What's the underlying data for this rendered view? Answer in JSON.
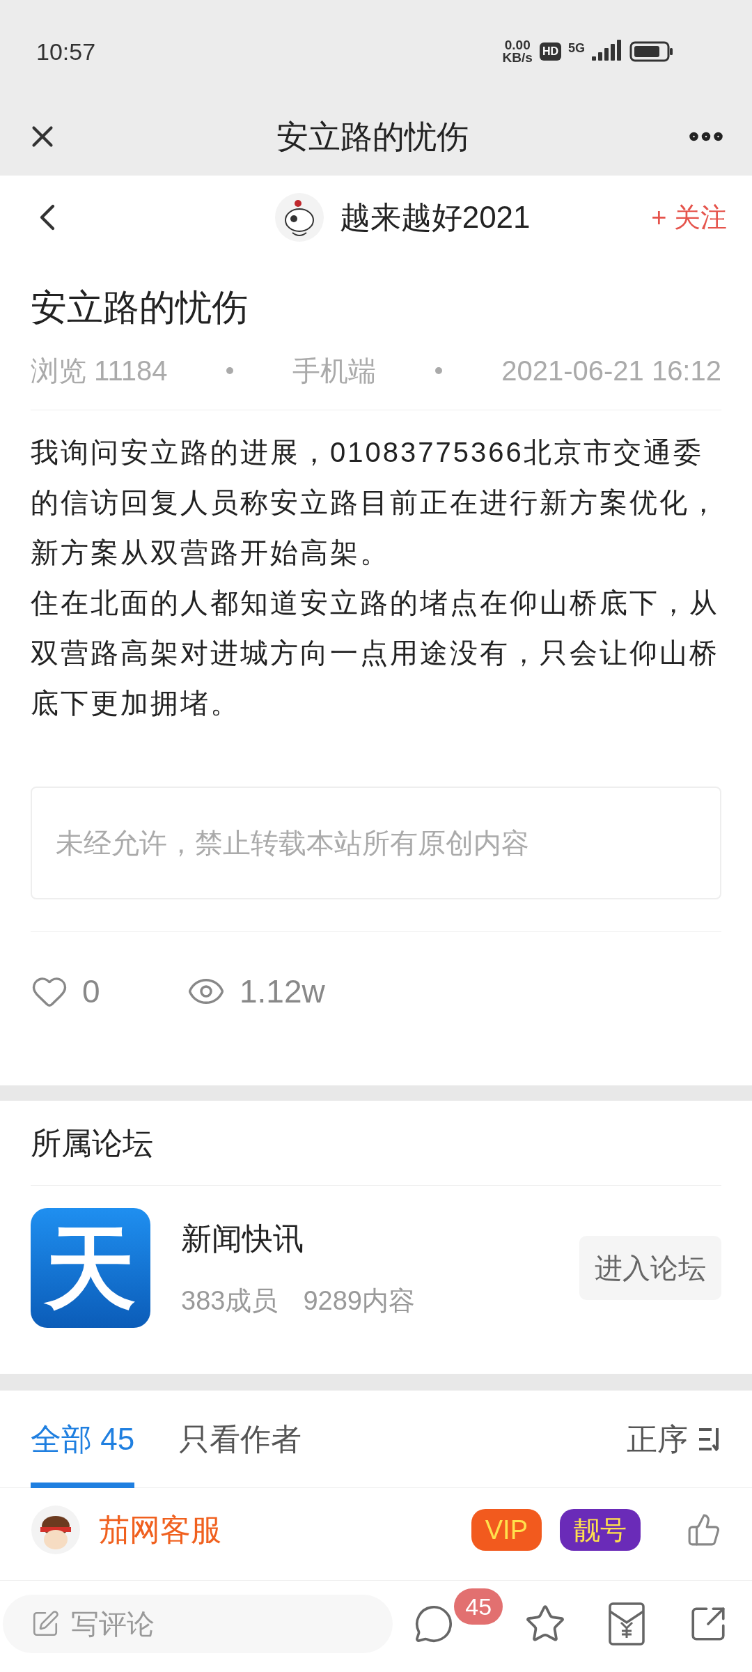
{
  "status_bar": {
    "time": "10:57",
    "net_speed": "0.00",
    "net_unit": "KB/s",
    "hd": "HD",
    "network": "5G"
  },
  "top_bar": {
    "title": "安立路的忧伤"
  },
  "author_bar": {
    "name": "越来越好2021",
    "follow": "+ 关注",
    "following": false
  },
  "post": {
    "title": "安立路的忧伤",
    "views": "浏览 11184",
    "source": "手机端",
    "date": "2021-06-21 16:12",
    "paragraphs": [
      "我询问安立路的进展，01083775366北京市交通委的信访回复人员称安立路目前正在进行新方案优化，新方案从双营路开始高架。",
      "住在北面的人都知道安立路的堵点在仰山桥底下，从双营路高架对进城方向一点用途没有，只会让仰山桥底下更加拥堵。"
    ],
    "notice": "未经允许，禁止转载本站所有原创内容",
    "likes": "0",
    "liked": false,
    "view_count": "1.12w"
  },
  "forum": {
    "heading": "所属论坛",
    "logo": "天",
    "name": "新闻快讯",
    "members": "383成员",
    "posts": "9289内容",
    "enter": "进入论坛"
  },
  "comment_tabs": [
    {
      "label": "全部 45",
      "selected": true
    },
    {
      "label": "只看作者",
      "selected": false
    }
  ],
  "sort": "正序",
  "comments": [
    {
      "name": "茄网客服",
      "badges": [
        {
          "text": "VIP",
          "color": "#f25a1e"
        },
        {
          "text": "靓号",
          "color": "#6a2bb8"
        }
      ]
    }
  ],
  "bottom_bar": {
    "placeholder": "写评论",
    "comment_count": "45"
  }
}
